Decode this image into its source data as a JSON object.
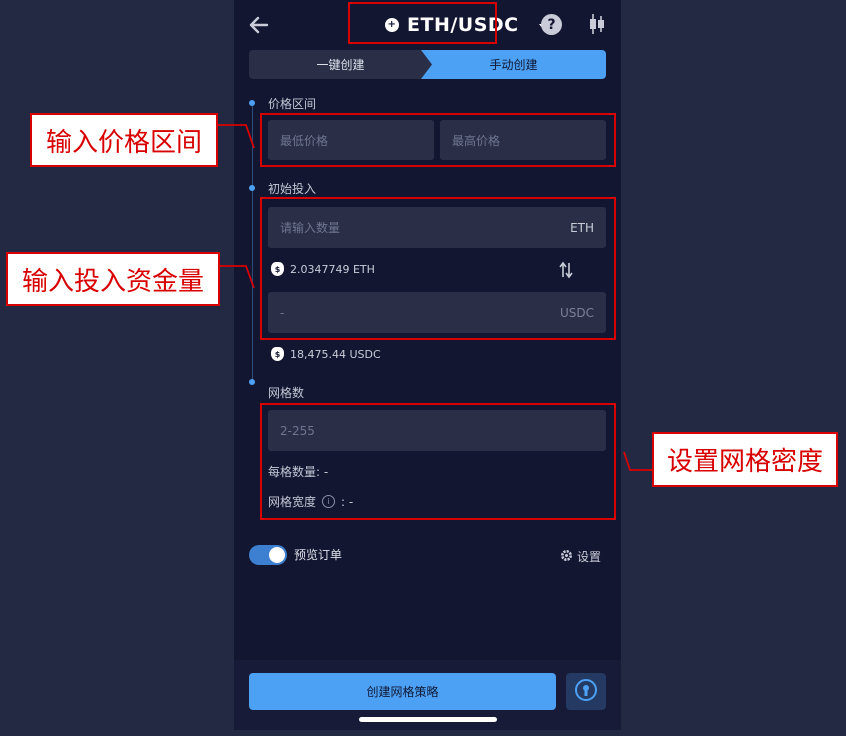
{
  "header": {
    "back_icon": "arrow-left-icon",
    "pair": "ETH/USDC",
    "pair_icon": "coin-plus-icon",
    "dropdown_icon": "caret-down-icon",
    "help_icon": "question-circle-icon",
    "chart_icon": "candlestick-icon"
  },
  "tabs": [
    {
      "label": "一键创建",
      "active": false
    },
    {
      "label": "手动创建",
      "active": true
    }
  ],
  "price_range": {
    "label": "价格区间",
    "min_placeholder": "最低价格",
    "max_placeholder": "最高价格"
  },
  "investment": {
    "label": "初始投入",
    "amount_placeholder": "请输入数量",
    "amount_unit": "ETH",
    "eth_balance": "2.0347749 ETH",
    "usdc_value": "-",
    "usdc_unit": "USDC",
    "usdc_balance": "18,475.44 USDC",
    "swap_icon": "swap-vertical-icon",
    "balance_icon": "money-bag-icon"
  },
  "grid": {
    "label": "网格数",
    "placeholder": "2-255",
    "per_grid_qty": "每格数量: -",
    "grid_width_label": "网格宽度",
    "grid_width_value": ": -"
  },
  "preview": {
    "label": "预览订单",
    "enabled": true
  },
  "settings": {
    "label": "设置",
    "icon": "gear-icon"
  },
  "footer": {
    "create_label": "创建网格策略",
    "assist_icon": "keyhole-icon"
  },
  "annotations": {
    "price_range": "输入价格区间",
    "investment": "输入投入资金量",
    "grid_density": "设置网格密度"
  },
  "colors": {
    "background": "#232843",
    "app_background": "#131631",
    "accent": "#4da1f5",
    "field": "#2a2f47",
    "annotation_red": "#d80000"
  }
}
